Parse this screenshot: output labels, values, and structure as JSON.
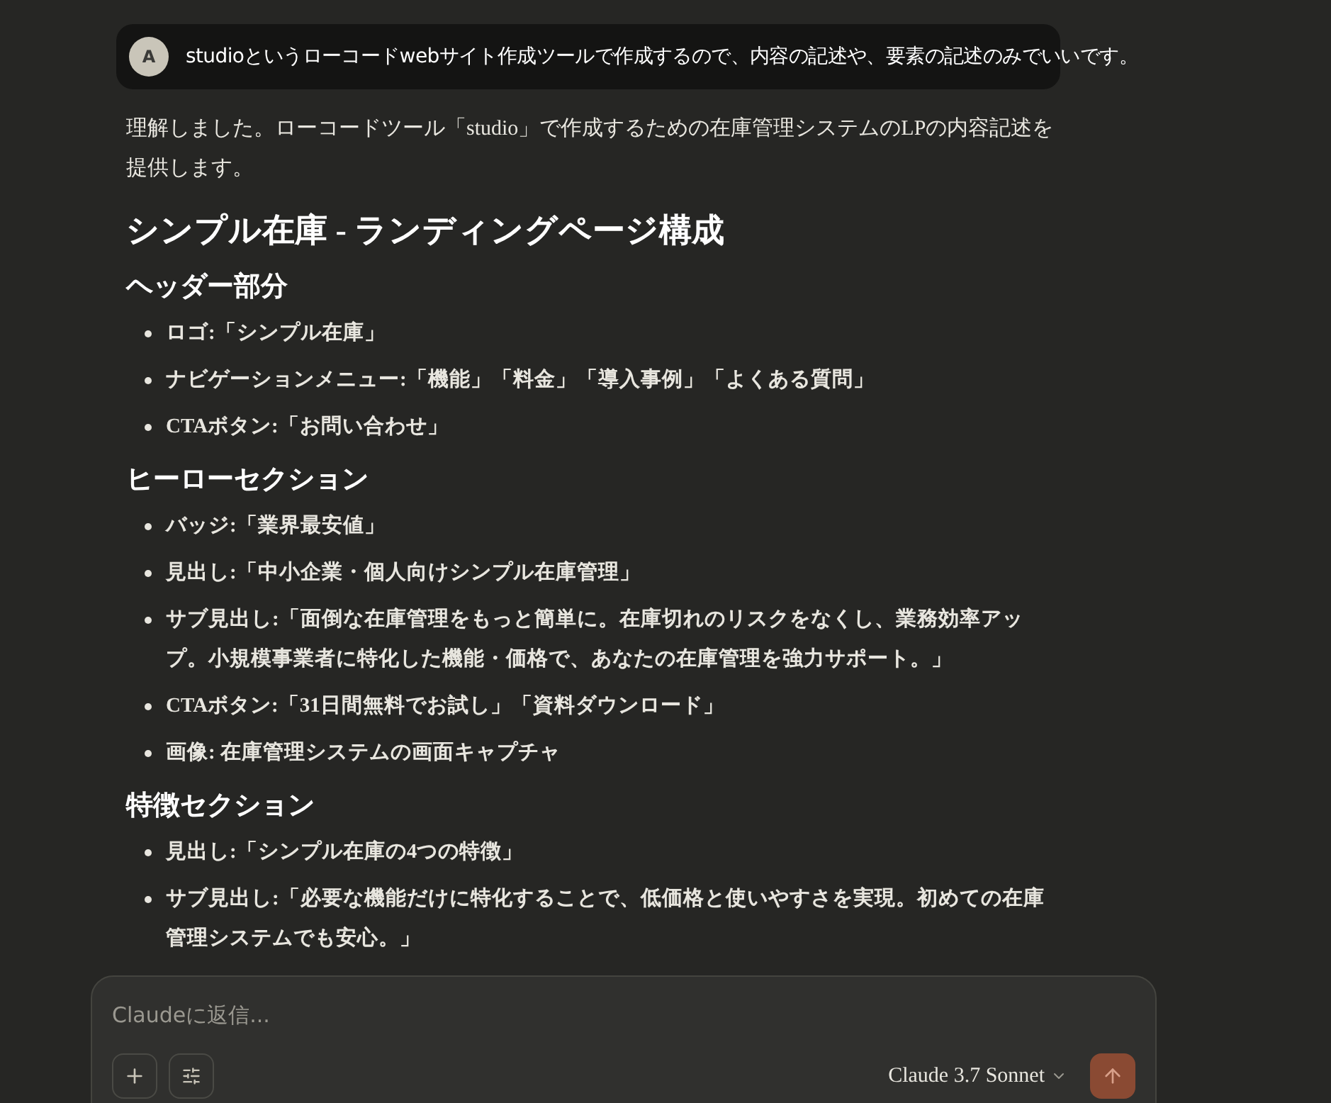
{
  "user_message": {
    "avatar": "A",
    "text": "studioというローコードwebサイト作成ツールで作成するので、内容の記述や、要素の記述のみでいいです。"
  },
  "response": {
    "intro": "理解しました。ローコードツール「studio」で作成するための在庫管理システムのLPの内容記述を提供します。",
    "title": "シンプル在庫 - ランディングページ構成",
    "sections": [
      {
        "heading": "ヘッダー部分",
        "items": [
          "ロゴ:「シンプル在庫」",
          "ナビゲーションメニュー:「機能」「料金」「導入事例」「よくある質問」",
          "CTAボタン:「お問い合わせ」"
        ]
      },
      {
        "heading": "ヒーローセクション",
        "items": [
          "バッジ:「業界最安値」",
          "見出し:「中小企業・個人向けシンプル在庫管理」",
          "サブ見出し:「面倒な在庫管理をもっと簡単に。在庫切れのリスクをなくし、業務効率アップ。小規模事業者に特化した機能・価格で、あなたの在庫管理を強力サポート。」",
          "CTAボタン:「31日間無料でお試し」「資料ダウンロード」",
          "画像: 在庫管理システムの画面キャプチャ"
        ]
      },
      {
        "heading": "特徴セクション",
        "items": [
          "見出し:「シンプル在庫の4つの特徴」",
          "サブ見出し:「必要な機能だけに特化することで、低価格と使いやすさを実現。初めての在庫管理システムでも安心。」"
        ]
      }
    ]
  },
  "composer": {
    "placeholder": "Claudeに返信...",
    "model": "Claude 3.7 Sonnet"
  }
}
